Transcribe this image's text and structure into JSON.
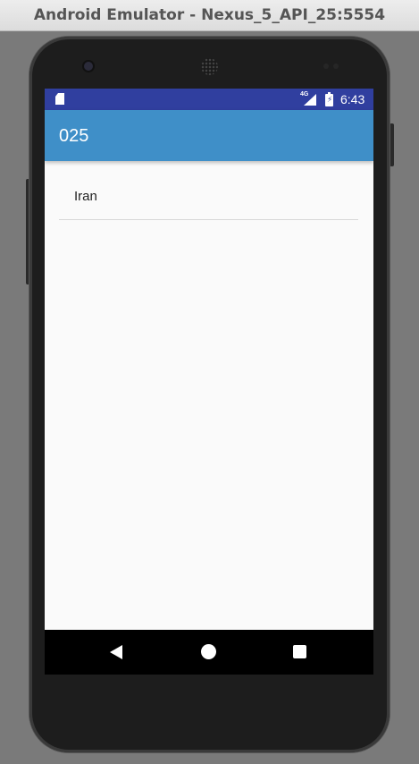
{
  "window": {
    "title": "Android Emulator - Nexus_5_API_25:5554"
  },
  "status_bar": {
    "network": "4G",
    "time": "6:43",
    "color": "#303f9f"
  },
  "app_bar": {
    "title": "025",
    "color": "#3f8fc8"
  },
  "list": {
    "items": [
      "Iran"
    ]
  },
  "nav_bar": {
    "back": "back-icon",
    "home": "home-icon",
    "recents": "recents-icon"
  }
}
